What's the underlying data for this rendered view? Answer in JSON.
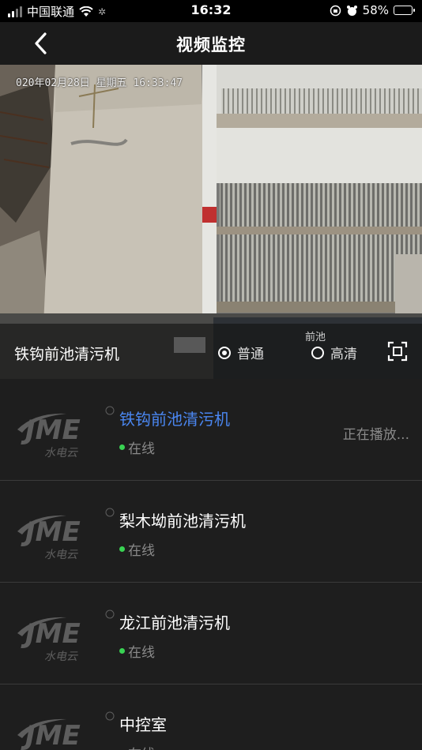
{
  "status_bar": {
    "carrier": "中国联通",
    "time": "16:32",
    "battery": "58%",
    "battery_level": 0.58
  },
  "nav": {
    "title": "视频监控",
    "back_icon": "chevron-left-icon"
  },
  "video": {
    "osd_timestamp": "020年02月28日 星期五 16:33:47",
    "camera_tag": "前池",
    "camera_name": "铁钩前池清污机",
    "quality_options": [
      {
        "label": "普通",
        "selected": true
      },
      {
        "label": "高清",
        "selected": false
      }
    ],
    "fullscreen_icon": "fullscreen-icon"
  },
  "devices": [
    {
      "name": "铁钩前池清污机",
      "status": "在线",
      "active": true,
      "playing_text": "正在播放..."
    },
    {
      "name": "梨木坳前池清污机",
      "status": "在线",
      "active": false
    },
    {
      "name": "龙江前池清污机",
      "status": "在线",
      "active": false
    },
    {
      "name": "中控室",
      "status": "在线",
      "active": false
    }
  ],
  "logo": {
    "brand": "JME",
    "subtitle": "水电云"
  },
  "colors": {
    "accent_blue": "#4a86f0",
    "online_green": "#39d353",
    "background": "#1e1e1e"
  }
}
